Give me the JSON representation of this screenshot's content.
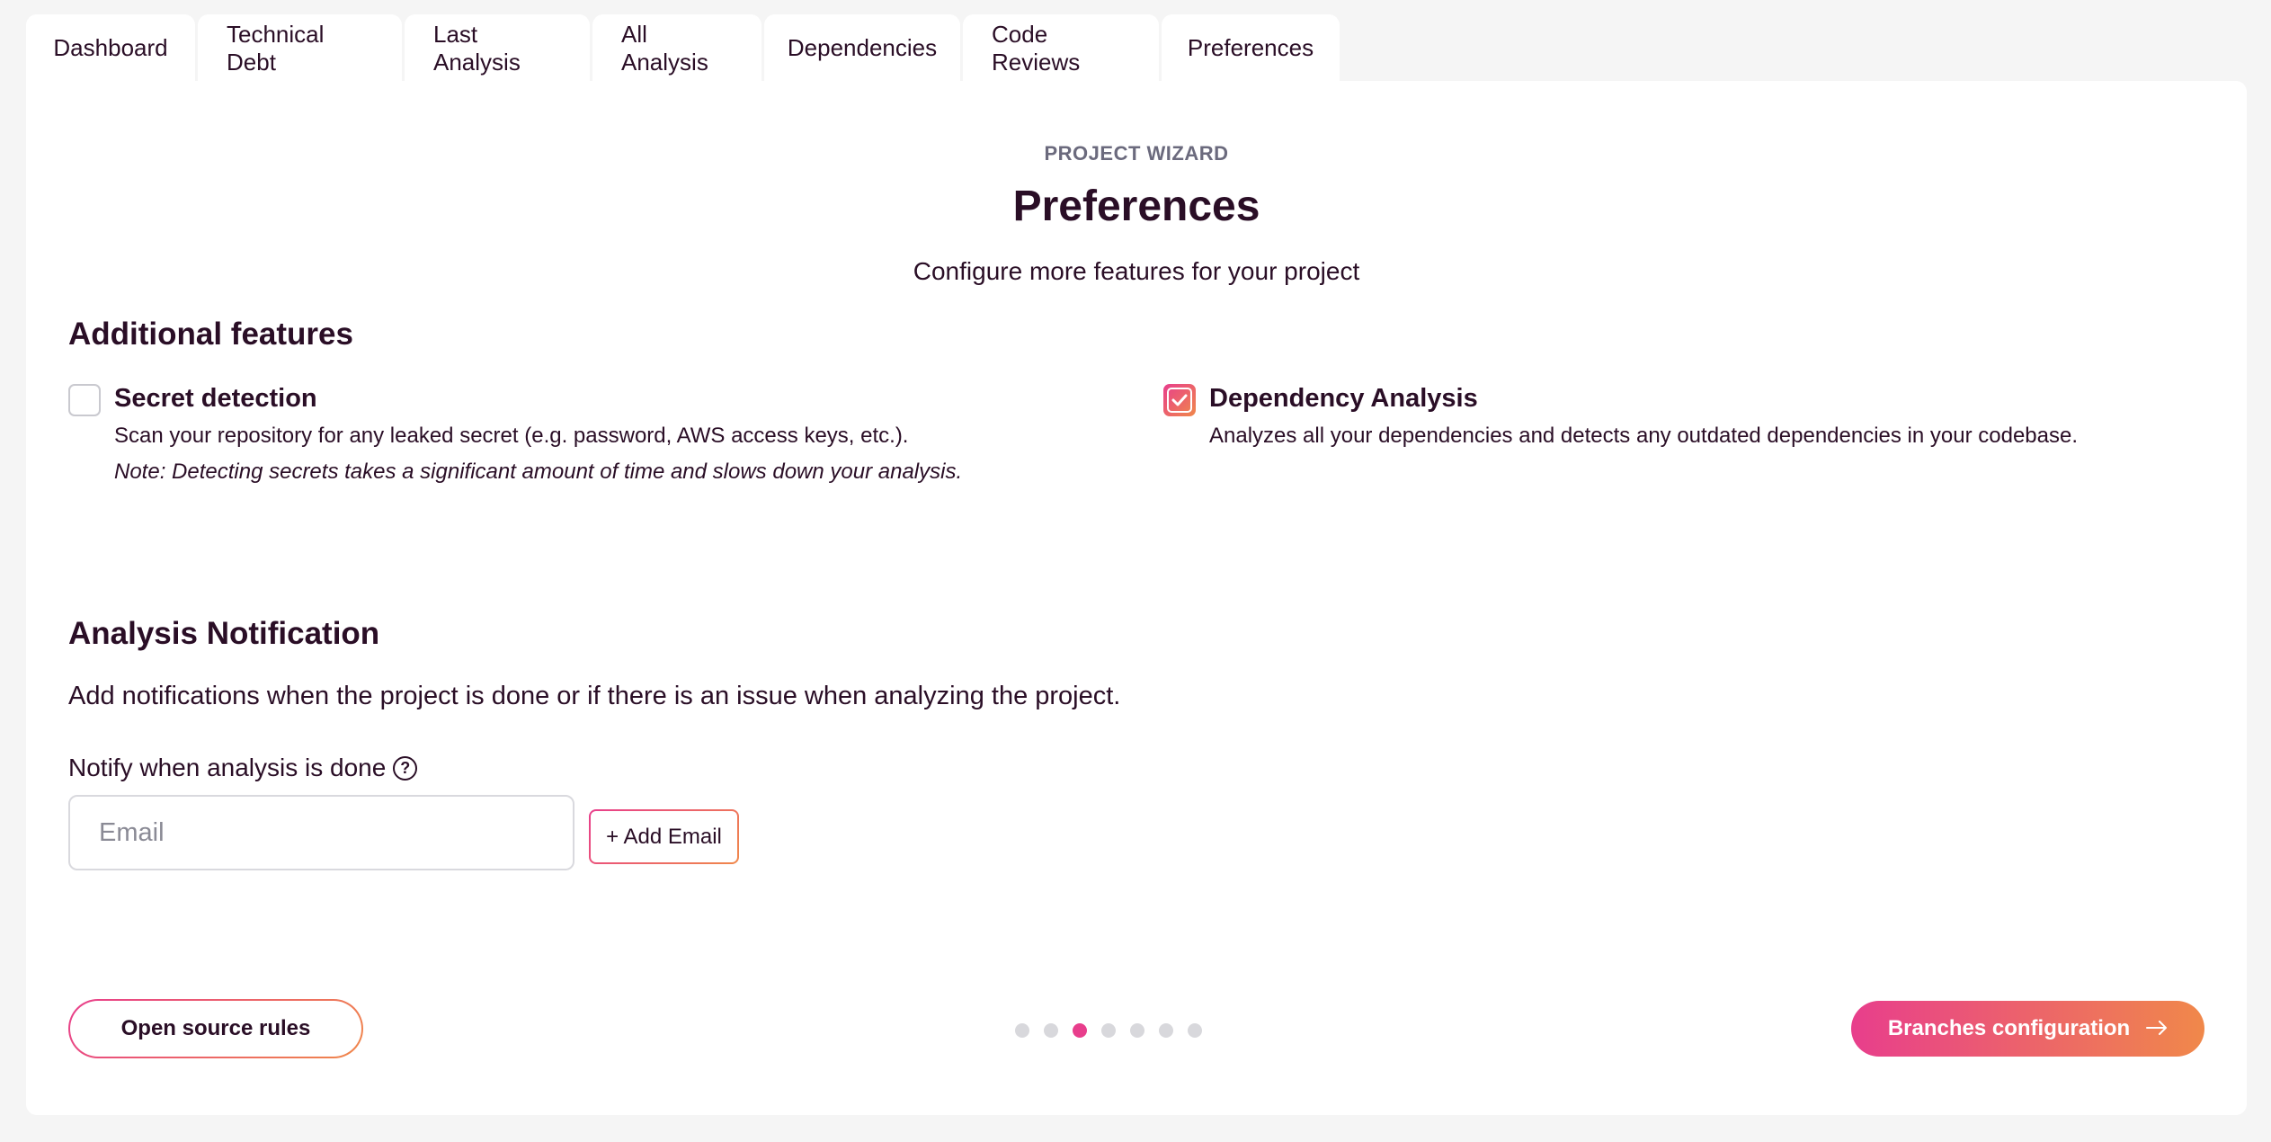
{
  "tabs": [
    {
      "label": "Dashboard"
    },
    {
      "label": "Technical Debt"
    },
    {
      "label": "Last Analysis"
    },
    {
      "label": "All Analysis"
    },
    {
      "label": "Dependencies"
    },
    {
      "label": "Code Reviews"
    },
    {
      "label": "Preferences"
    }
  ],
  "wizard": {
    "eyebrow": "PROJECT WIZARD",
    "title": "Preferences",
    "subtitle": "Configure more features for your project"
  },
  "additional_features": {
    "heading": "Additional features",
    "secret_detection": {
      "title": "Secret detection",
      "description": "Scan your repository for any leaked secret (e.g. password, AWS access keys, etc.).",
      "note": "Note: Detecting secrets takes a significant amount of time and slows down your analysis.",
      "checked": false
    },
    "dependency_analysis": {
      "title": "Dependency Analysis",
      "description": "Analyzes all your dependencies and detects any outdated dependencies in your codebase.",
      "checked": true
    }
  },
  "notification": {
    "heading": "Analysis Notification",
    "description": "Add notifications when the project is done or if there is an issue when analyzing the project.",
    "notify_label": "Notify when analysis is done",
    "email_placeholder": "Email",
    "email_value": "",
    "add_email_label": "+ Add Email"
  },
  "footer": {
    "back_label": "Open source rules",
    "next_label": "Branches configuration",
    "steps_total": 7,
    "current_step": 3
  },
  "colors": {
    "gradient_start": "#e83e8c",
    "gradient_end": "#f0884a",
    "text": "#2a0e26",
    "muted": "#6b6a7d"
  },
  "icons": {
    "help": "question-circle-icon",
    "arrow": "arrow-right-icon",
    "check": "checkmark-icon"
  }
}
